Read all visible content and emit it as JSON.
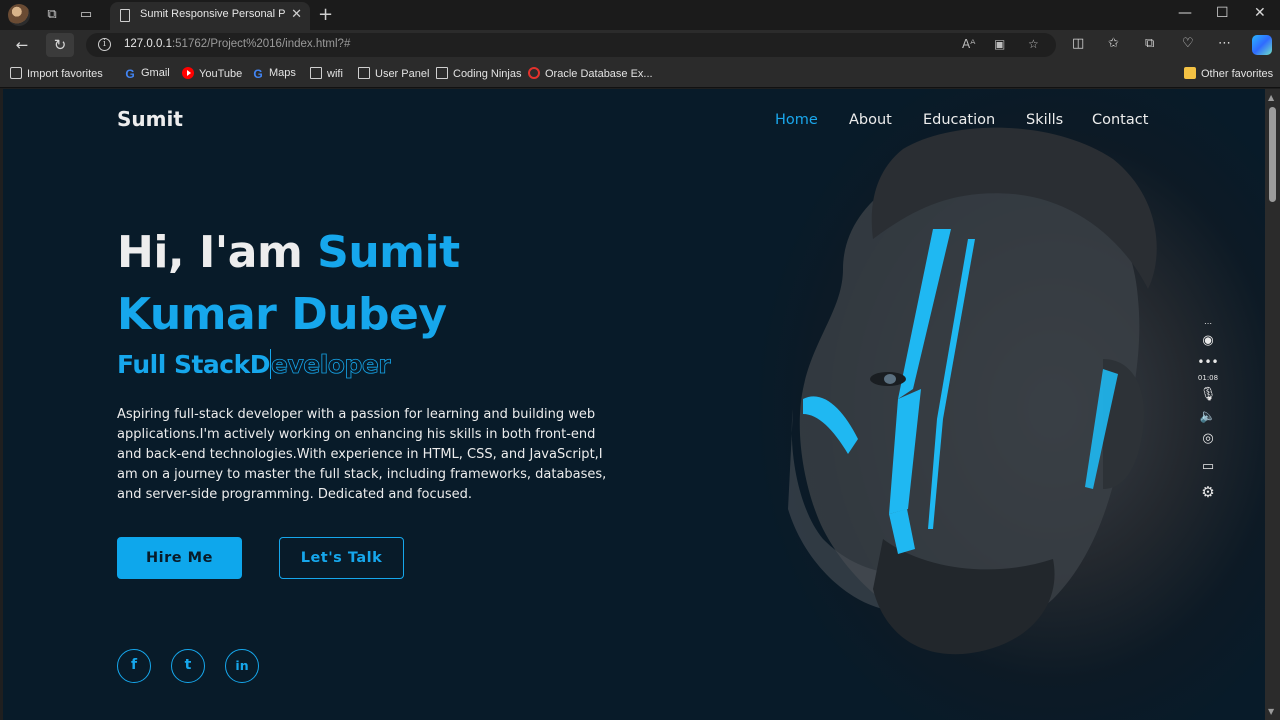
{
  "browser": {
    "tab_title": "Sumit Responsive Personal Portfolio",
    "url_host": "127.0.0.1",
    "url_rest": ":51762/Project%2016/index.html?#",
    "favorites": [
      {
        "label": "Import favorites",
        "icon": "import-icon"
      },
      {
        "label": "Gmail",
        "icon": "google-icon"
      },
      {
        "label": "YouTube",
        "icon": "youtube-icon"
      },
      {
        "label": "Maps",
        "icon": "google-icon"
      },
      {
        "label": "wifi",
        "icon": "page-icon"
      },
      {
        "label": "User Panel",
        "icon": "page-icon"
      },
      {
        "label": "Coding Ninjas",
        "icon": "page-icon"
      },
      {
        "label": "Oracle Database Ex...",
        "icon": "oracle-icon"
      }
    ],
    "other_favorites": "Other favorites"
  },
  "site": {
    "logo": "Sumit",
    "nav": [
      "Home",
      "About",
      "Education",
      "Skills",
      "Contact"
    ],
    "active_nav": "Home",
    "greeting": "Hi, I'am ",
    "name_first": "Sumit",
    "name_rest": "Kumar Dubey",
    "role_typed": "Full StackD",
    "role_rest": "eveloper",
    "description": "Aspiring full-stack developer with a passion for learning and building web applications.I'm actively working on enhancing his skills in both front-end and back-end technologies.With experience in HTML, CSS, and JavaScript,I am on a journey to master the full stack, including frameworks, databases, and server-side programming. Dedicated and focused.",
    "btn_hire": "Hire Me",
    "btn_talk": "Let's Talk",
    "social": [
      {
        "icon": "facebook-icon",
        "glyph": "f"
      },
      {
        "icon": "twitter-icon",
        "glyph": "t"
      },
      {
        "icon": "linkedin-icon",
        "glyph": "in"
      }
    ],
    "accent_color": "#16a7ec",
    "background_color": "#081b29"
  },
  "recorder": {
    "timer": "01:08"
  }
}
